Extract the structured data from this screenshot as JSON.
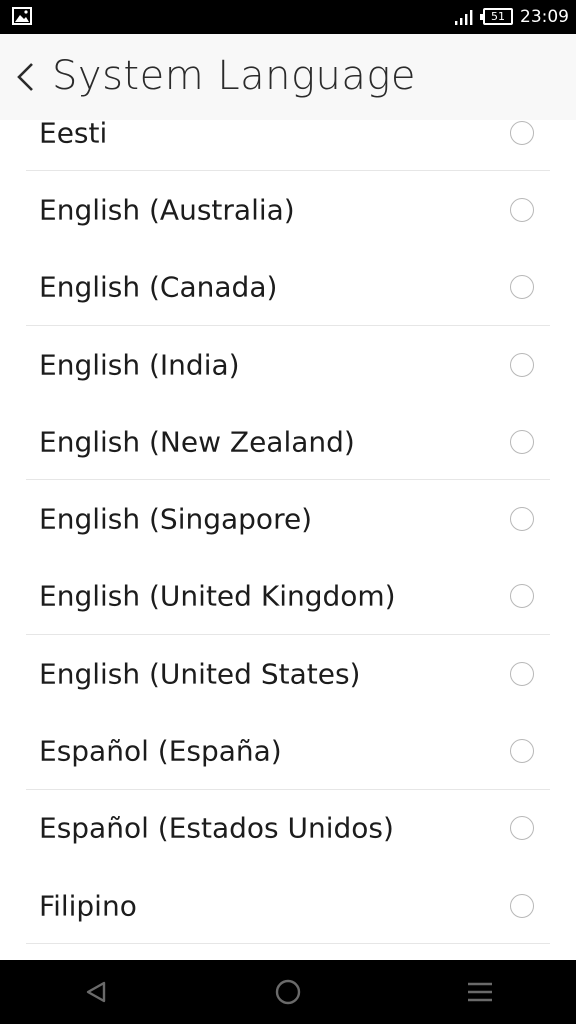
{
  "status_bar": {
    "time": "23:09",
    "battery": "51",
    "icons": [
      "gallery-icon",
      "signal-icon",
      "battery-icon"
    ]
  },
  "header": {
    "title": "System Language",
    "back_icon": "chevron-left-icon"
  },
  "languages": [
    "Eesti",
    "English (Australia)",
    "English (Canada)",
    "English (India)",
    "English (New Zealand)",
    "English (Singapore)",
    "English (United Kingdom)",
    "English (United States)",
    "Español (España)",
    "Español (Estados Unidos)",
    "Filipino"
  ],
  "nav_bar": {
    "icons": [
      "nav-back-icon",
      "nav-home-icon",
      "nav-menu-icon"
    ]
  },
  "colors": {
    "status_bar": "#000000",
    "header_bg": "#f8f8f8",
    "text": "#1c1c1c",
    "divider": "#e6e6e6",
    "radio_border": "#b8b8b8"
  }
}
